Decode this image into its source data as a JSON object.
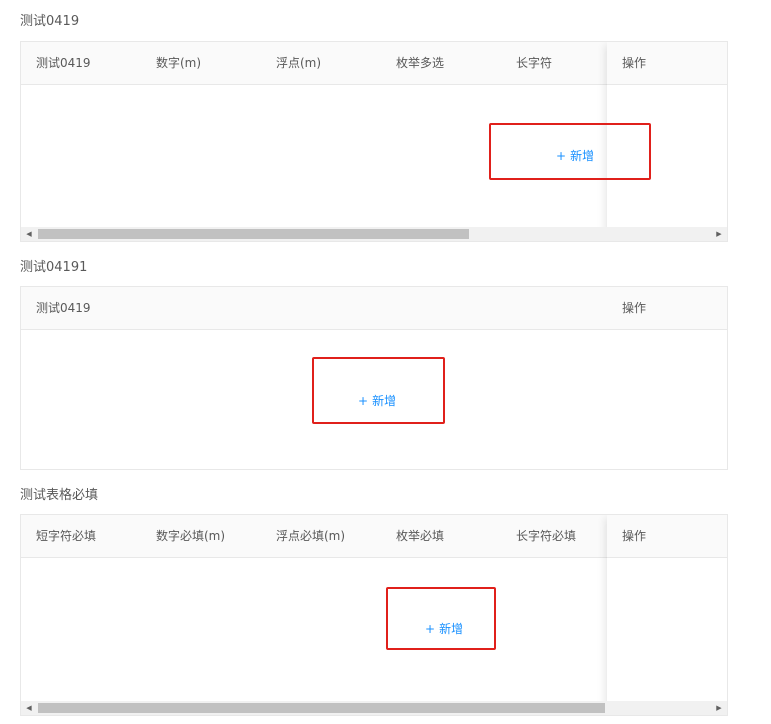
{
  "sections": [
    {
      "title": "测试0419",
      "columns": [
        "测试0419",
        "数字(m)",
        "浮点(m)",
        "枚举多选",
        "长字符"
      ],
      "action_column": "操作",
      "add_label": "新增",
      "add_icon": "plus-icon",
      "horizontal_scrollbar": true
    },
    {
      "title": "测试04191",
      "columns": [
        "测试0419"
      ],
      "action_column": "操作",
      "add_label": "新增",
      "add_icon": "plus-icon",
      "horizontal_scrollbar": false
    },
    {
      "title": "测试表格必填",
      "columns": [
        "短字符必填",
        "数字必填(m)",
        "浮点必填(m)",
        "枚举必填",
        "长字符必填"
      ],
      "action_column": "操作",
      "add_label": "新增",
      "add_icon": "plus-icon",
      "horizontal_scrollbar": true
    }
  ],
  "colors": {
    "link": "#1890ff",
    "highlight_box": "#e0201b",
    "header_bg": "#fafafa",
    "border": "#e8e8e8"
  }
}
